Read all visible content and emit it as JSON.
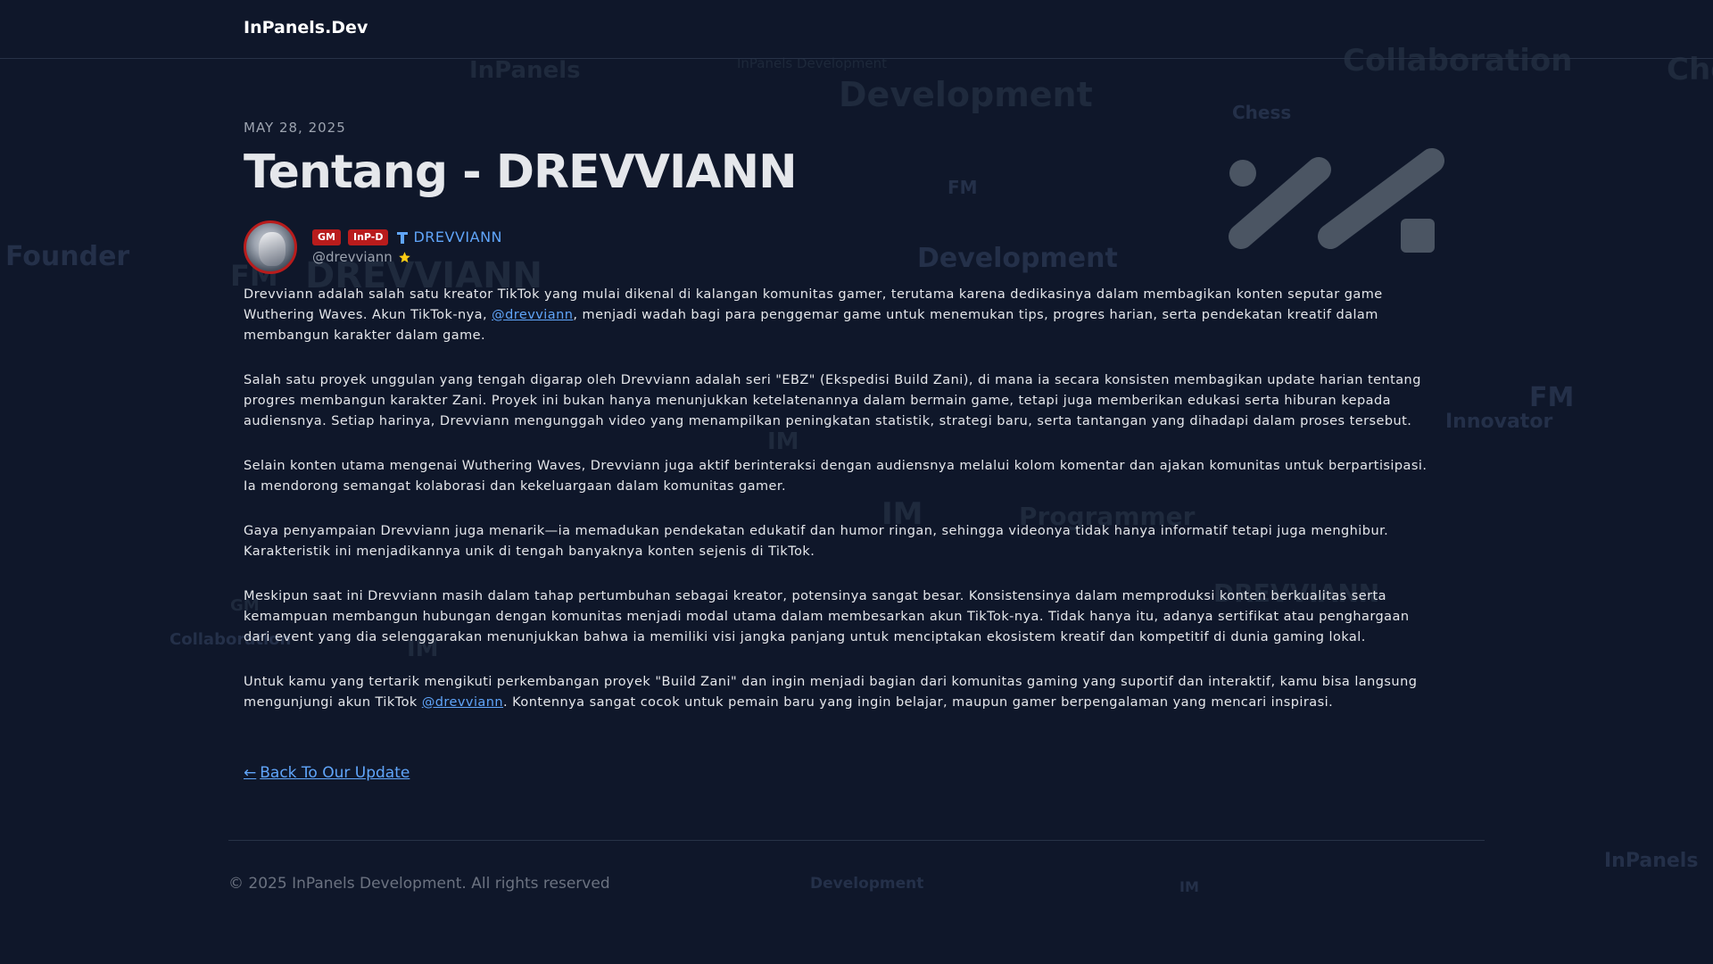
{
  "header": {
    "brand": "InPanels.Dev"
  },
  "background_words": [
    "InPanels",
    "Development",
    "Collaboration",
    "Che",
    "Chess",
    "FM",
    "Founder",
    "FM",
    "DREVVIANN",
    "Development",
    "FM",
    "Innovator",
    "IM",
    "Programmer",
    "IM",
    "DREVVIANN",
    "GM",
    "Collaboration",
    "IM",
    "InPanels",
    "Development",
    "IM",
    "InPanels Development"
  ],
  "post": {
    "date": "MAY 28, 2025",
    "title": "Tentang - DREVVIANN",
    "author": {
      "badges": [
        "GM",
        "InP-D"
      ],
      "name": "DREVVIANN",
      "handle": "@drevviann",
      "verified_icon": "verified-t-icon",
      "star_icon": "star-icon"
    },
    "paragraphs": [
      {
        "before": "Drevviann adalah salah satu kreator TikTok yang mulai dikenal di kalangan komunitas gamer, terutama karena dedikasinya dalam membagikan konten seputar game\nWuthering Waves. Akun TikTok-nya, ",
        "link": "@drevviann",
        "after": ", menjadi wadah bagi para penggemar game untuk menemukan tips, progres harian, serta pendekatan kreatif dalam\nmembangun karakter dalam game."
      },
      {
        "before": "Salah satu proyek unggulan yang tengah digarap oleh Drevviann adalah seri \"EBZ\" (Ekspedisi Build Zani), di mana ia secara konsisten membagikan update harian tentang\nprogres membangun karakter Zani. Proyek ini bukan hanya menunjukkan ketelatenannya dalam bermain game, tetapi juga memberikan edukasi serta hiburan kepada\naudiensnya. Setiap harinya, Drevviann mengunggah video yang menampilkan peningkatan statistik, strategi baru, serta tantangan yang dihadapi dalam proses tersebut.",
        "link": "",
        "after": ""
      },
      {
        "before": "Selain konten utama mengenai Wuthering Waves, Drevviann juga aktif berinteraksi dengan audiensnya melalui kolom komentar dan ajakan komunitas untuk berpartisipasi.\nIa mendorong semangat kolaborasi dan kekeluargaan dalam komunitas gamer.",
        "link": "",
        "after": ""
      },
      {
        "before": "Gaya penyampaian Drevviann juga menarik—ia memadukan pendekatan edukatif dan humor ringan, sehingga videonya tidak hanya informatif tetapi juga menghibur.\nKarakteristik ini menjadikannya unik di tengah banyaknya konten sejenis di TikTok.",
        "link": "",
        "after": ""
      },
      {
        "before": "Meskipun saat ini Drevviann masih dalam tahap pertumbuhan sebagai kreator, potensinya sangat besar. Konsistensinya dalam memproduksi konten berkualitas serta\nkemampuan membangun hubungan dengan komunitas menjadi modal utama dalam membesarkan akun TikTok-nya. Tidak hanya itu, adanya sertifikat atau penghargaan\ndari event yang dia selenggarakan menunjukkan bahwa ia memiliki visi jangka panjang untuk menciptakan ekosistem kreatif dan kompetitif di dunia gaming lokal.",
        "link": "",
        "after": ""
      },
      {
        "before": "Untuk kamu yang tertarik mengikuti perkembangan proyek \"Build Zani\" dan ingin menjadi bagian dari komunitas gaming yang suportif dan interaktif, kamu bisa langsung\nmengunjungi akun TikTok ",
        "link": "@drevviann",
        "after": ". Kontennya sangat cocok untuk pemain baru yang ingin belajar, maupun gamer berpengalaman yang mencari inspirasi."
      }
    ],
    "back_link": {
      "arrow": "←",
      "label": "Back To Our Update"
    }
  },
  "footer": {
    "copyright": "© 2025 InPanels Development. All rights reserved"
  },
  "colors": {
    "background": "#0f172a",
    "accent_link": "#60a5fa",
    "badge_red": "#b91c1c",
    "star": "#facc15"
  }
}
